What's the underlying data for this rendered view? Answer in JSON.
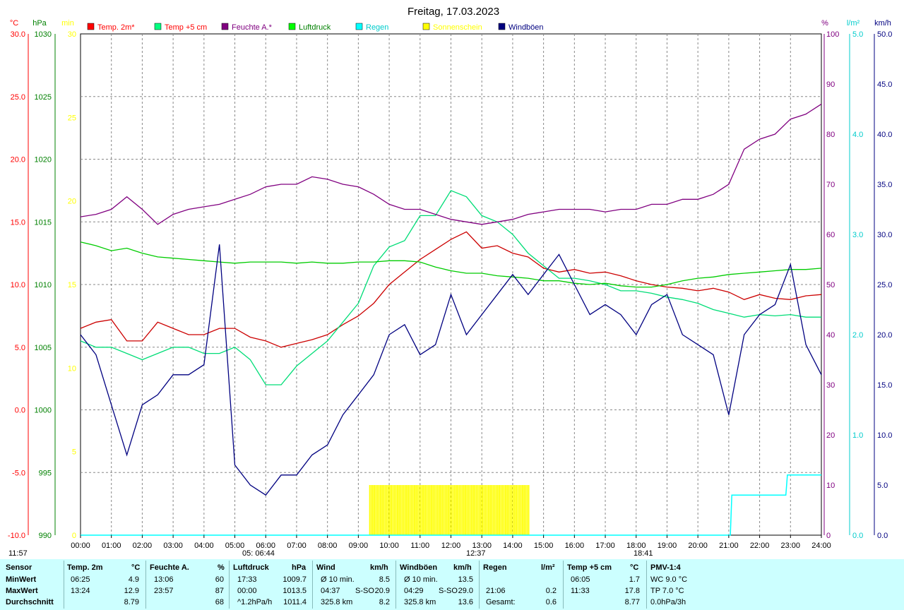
{
  "chart_data": {
    "type": "line",
    "title": "Freitag, 17.03.2023",
    "x_ticks": [
      "00:00",
      "01:00",
      "02:00",
      "03:00",
      "04:00",
      "05:00",
      "06:00",
      "07:00",
      "08:00",
      "09:00",
      "10:00",
      "11:00",
      "12:00",
      "13:00",
      "14:00",
      "15:00",
      "16:00",
      "17:00",
      "18:00",
      "19:00",
      "20:00",
      "21:00",
      "22:00",
      "23:00",
      "24:00"
    ],
    "xlim": [
      0,
      24
    ],
    "axes": {
      "temp": {
        "unit": "°C",
        "ylim": [
          -10,
          30
        ],
        "ticks": [
          "30.0",
          "25.0",
          "20.0",
          "15.0",
          "10.0",
          "5.0",
          "0.0",
          "-5.0",
          "-10.0"
        ]
      },
      "pressure": {
        "unit": "hPa",
        "ylim": [
          990,
          1030
        ],
        "ticks": [
          "1030",
          "1025",
          "1020",
          "1015",
          "1010",
          "1005",
          "1000",
          "995",
          "990"
        ]
      },
      "sunshine": {
        "unit": "min",
        "ylim": [
          0,
          30
        ],
        "ticks": [
          "30",
          "25",
          "20",
          "15",
          "10",
          "5",
          "0"
        ]
      },
      "humidity": {
        "unit": "%",
        "ylim": [
          0,
          100
        ],
        "ticks": [
          "100",
          "90",
          "80",
          "70",
          "60",
          "50",
          "40",
          "30",
          "20",
          "10",
          "0"
        ]
      },
      "rain": {
        "unit": "l/m²",
        "ylim": [
          0,
          5
        ],
        "ticks": [
          "5.0",
          "4.0",
          "3.0",
          "2.0",
          "1.0",
          "0.0"
        ]
      },
      "wind": {
        "unit": "km/h",
        "ylim": [
          0,
          50
        ],
        "ticks": [
          "50.0",
          "45.0",
          "40.0",
          "35.0",
          "30.0",
          "25.0",
          "20.0",
          "15.0",
          "10.0",
          "5.0",
          "0.0"
        ]
      }
    },
    "legend": [
      {
        "name": "Temp. 2m*",
        "color": "#ff0000",
        "text_color": "#ff0000"
      },
      {
        "name": "Temp +5 cm",
        "color": "#00ff80",
        "text_color": "#ff0000"
      },
      {
        "name": "Feuchte A.*",
        "color": "#800080",
        "text_color": "#800080"
      },
      {
        "name": "Luftdruck",
        "color": "#00ff00",
        "text_color": "#008000"
      },
      {
        "name": "Regen",
        "color": "#00ffff",
        "text_color": "#00cccc"
      },
      {
        "name": "Sonnenschein",
        "color": "#ffff00",
        "text_color": "#ffff00"
      },
      {
        "name": "Windböen",
        "color": "#000080",
        "text_color": "#000080"
      }
    ],
    "series": [
      {
        "name": "Temp. 2m*",
        "axis": "temp",
        "color": "#cc0000",
        "x": [
          0,
          0.5,
          1,
          1.5,
          2,
          2.5,
          3,
          3.5,
          4,
          4.5,
          5,
          5.5,
          6,
          6.5,
          7,
          7.5,
          8,
          8.5,
          9,
          9.5,
          10,
          10.5,
          11,
          11.5,
          12,
          12.5,
          13,
          13.5,
          14,
          14.5,
          15,
          15.5,
          16,
          16.5,
          17,
          17.5,
          18,
          18.5,
          19,
          19.5,
          20,
          20.5,
          21,
          21.5,
          22,
          22.5,
          23,
          23.5,
          24
        ],
        "y": [
          6.5,
          7,
          7.2,
          5.5,
          5.5,
          7,
          6.5,
          6,
          6,
          6.5,
          6.5,
          5.8,
          5.5,
          5,
          5.3,
          5.6,
          6,
          6.8,
          7.5,
          8.5,
          10,
          11,
          12,
          12.8,
          13.6,
          14.2,
          12.9,
          13.1,
          12.5,
          12.2,
          11.3,
          11,
          11.2,
          10.9,
          11,
          10.7,
          10.3,
          10,
          9.8,
          9.7,
          9.5,
          9.7,
          9.4,
          8.8,
          9.2,
          8.9,
          8.8,
          9.1,
          9.2
        ]
      },
      {
        "name": "Temp +5 cm",
        "axis": "temp",
        "color": "#00dd77",
        "x": [
          0,
          0.5,
          1,
          1.5,
          2,
          2.5,
          3,
          3.5,
          4,
          4.5,
          5,
          5.5,
          6,
          6.5,
          7,
          7.5,
          8,
          8.5,
          9,
          9.5,
          10,
          10.5,
          11,
          11.5,
          12,
          12.5,
          13,
          13.5,
          14,
          14.5,
          15,
          15.5,
          16,
          16.5,
          17,
          17.5,
          18,
          18.5,
          19,
          19.5,
          20,
          20.5,
          21,
          21.5,
          22,
          22.5,
          23,
          23.5,
          24
        ],
        "y": [
          5.5,
          5,
          5,
          4.5,
          4,
          4.5,
          5,
          5,
          4.5,
          4.5,
          5,
          4,
          2,
          2,
          3.5,
          4.5,
          5.5,
          7,
          8.5,
          11.5,
          13,
          13.5,
          15.5,
          15.5,
          17.5,
          17,
          15.5,
          15,
          14,
          12.5,
          11.5,
          10.5,
          10.5,
          10.3,
          10,
          9.5,
          9.5,
          9.3,
          9,
          8.8,
          8.5,
          8,
          7.7,
          7.4,
          7.6,
          7.5,
          7.6,
          7.4,
          7.4
        ]
      },
      {
        "name": "Feuchte A.*",
        "axis": "humidity",
        "color": "#800080",
        "x": [
          0,
          0.5,
          1,
          1.5,
          2,
          2.5,
          3,
          3.5,
          4,
          4.5,
          5,
          5.5,
          6,
          6.5,
          7,
          7.5,
          8,
          8.5,
          9,
          9.5,
          10,
          10.5,
          11,
          11.5,
          12,
          12.5,
          13,
          13.5,
          14,
          14.5,
          15,
          15.5,
          16,
          16.5,
          17,
          17.5,
          18,
          18.5,
          19,
          19.5,
          20,
          20.5,
          21,
          21.5,
          22,
          22.5,
          23,
          23.5,
          24
        ],
        "y": [
          63.5,
          64,
          65,
          67.5,
          65,
          62,
          64,
          65,
          65.5,
          66,
          67,
          68,
          69.5,
          70,
          70,
          71.5,
          71,
          70,
          69.5,
          68,
          66,
          65,
          65,
          64,
          63,
          62.5,
          62,
          62.5,
          63,
          64,
          64.5,
          65,
          65,
          65,
          64.5,
          65,
          65,
          66,
          66,
          67,
          67,
          68,
          70,
          77,
          79,
          80,
          83,
          84,
          86
        ]
      },
      {
        "name": "Luftdruck",
        "axis": "pressure",
        "color": "#00cc00",
        "x": [
          0,
          0.5,
          1,
          1.5,
          2,
          2.5,
          3,
          3.5,
          4,
          4.5,
          5,
          5.5,
          6,
          6.5,
          7,
          7.5,
          8,
          8.5,
          9,
          9.5,
          10,
          10.5,
          11,
          11.5,
          12,
          12.5,
          13,
          13.5,
          14,
          14.5,
          15,
          15.5,
          16,
          16.5,
          17,
          17.5,
          18,
          18.5,
          19,
          19.5,
          20,
          20.5,
          21,
          21.5,
          22,
          22.5,
          23,
          23.5,
          24
        ],
        "y": [
          1013.4,
          1013.1,
          1012.7,
          1012.9,
          1012.5,
          1012.2,
          1012.1,
          1012,
          1011.9,
          1011.8,
          1011.7,
          1011.8,
          1011.8,
          1011.8,
          1011.7,
          1011.8,
          1011.7,
          1011.7,
          1011.8,
          1011.8,
          1011.9,
          1011.9,
          1011.8,
          1011.4,
          1011.1,
          1010.9,
          1010.9,
          1010.7,
          1010.6,
          1010.5,
          1010.3,
          1010.3,
          1010.1,
          1010,
          1010.1,
          1009.9,
          1009.8,
          1009.8,
          1010,
          1010.3,
          1010.5,
          1010.6,
          1010.8,
          1010.9,
          1011,
          1011.1,
          1011.2,
          1011.2,
          1011.3
        ]
      },
      {
        "name": "Windböen",
        "axis": "wind",
        "color": "#000080",
        "x": [
          0,
          0.5,
          1,
          1.5,
          2,
          2.5,
          3,
          3.5,
          4,
          4.5,
          5,
          5.5,
          6,
          6.5,
          7,
          7.5,
          8,
          8.5,
          9,
          9.5,
          10,
          10.5,
          11,
          11.5,
          12,
          12.5,
          13,
          13.5,
          14,
          14.5,
          15,
          15.5,
          16,
          16.5,
          17,
          17.5,
          18,
          18.5,
          19,
          19.5,
          20,
          20.5,
          21,
          21.5,
          22,
          22.5,
          23,
          23.5,
          24
        ],
        "y": [
          20,
          18,
          13,
          8,
          13,
          14,
          16,
          16,
          17,
          29,
          7,
          5,
          4,
          6,
          6,
          8,
          9,
          12,
          14,
          16,
          20,
          21,
          18,
          19,
          24,
          20,
          22,
          24,
          26,
          24,
          26,
          28,
          25,
          22,
          23,
          22,
          20,
          23,
          24,
          20,
          19,
          18,
          12,
          20,
          22,
          23,
          27,
          19,
          16
        ]
      }
    ],
    "sunshine_bar": {
      "axis": "sunshine",
      "x_start": 9.35,
      "x_end": 14.55,
      "value": 3
    },
    "rain_steps": {
      "axis": "rain",
      "x": [
        0,
        21.05,
        21.1,
        22.85,
        22.9,
        24
      ],
      "y": [
        0,
        0,
        0.4,
        0.4,
        0.6,
        0.6
      ]
    },
    "markers": [
      {
        "label": "11:57",
        "color": "#ffff00"
      },
      {
        "label": "05:  06:44",
        "color": "#ffff00"
      },
      {
        "label": "12:37",
        "color": "#ffff00"
      },
      {
        "label": "18:41",
        "color": "#ffff00"
      }
    ]
  },
  "stats": {
    "headers": {
      "sensor": "Sensor",
      "temp": "Temp. 2m",
      "temp_unit": "°C",
      "hum": "Feuchte A.",
      "hum_unit": "%",
      "press": "Luftdruck",
      "press_unit": "hPa",
      "wind": "Wind",
      "wind_unit": "km/h",
      "gust": "Windböen",
      "gust_unit": "km/h",
      "rain": "Regen",
      "rain_unit": "l/m²",
      "t5": "Temp +5 cm",
      "t5_unit": "°C",
      "pmv": "PMV-1:4"
    },
    "rows": [
      {
        "label": "MinWert",
        "temp_time": "06:25",
        "temp_val": "4.9",
        "hum_time": "13:06",
        "hum_val": "60",
        "press_time": "17:33",
        "press_val": "1009.7",
        "wind_time": "Ø 10 min.",
        "wind_dir": "",
        "wind_val": "8.5",
        "gust_time": "Ø 10 min.",
        "gust_dir": "",
        "gust_val": "13.5",
        "rain_time": "",
        "rain_val": "",
        "t5_time": "06:05",
        "t5_val": "1.7",
        "pmv": "WC 9.0 °C"
      },
      {
        "label": "MaxWert",
        "temp_time": "13:24",
        "temp_val": "12.9",
        "hum_time": "23:57",
        "hum_val": "87",
        "press_time": "00:00",
        "press_val": "1013.5",
        "wind_time": "04:37",
        "wind_dir": "S-SO",
        "wind_val": "20.9",
        "gust_time": "04:29",
        "gust_dir": "S-SO",
        "gust_val": "29.0",
        "rain_time": "21:06",
        "rain_val": "0.2",
        "t5_time": "11:33",
        "t5_val": "17.8",
        "pmv": "TP 7.0 °C"
      },
      {
        "label": "Durchschnitt",
        "temp_time": "",
        "temp_val": "8.79",
        "hum_time": "",
        "hum_val": "68",
        "press_time": "^1.2hPa/h",
        "press_val": "1011.4",
        "wind_time": "325.8 km",
        "wind_dir": "",
        "wind_val": "8.2",
        "gust_time": "325.8 km",
        "gust_dir": "",
        "gust_val": "13.6",
        "rain_time": "Gesamt:",
        "rain_val": "0.6",
        "t5_time": "",
        "t5_val": "8.77",
        "pmv": "0.0hPa/3h"
      }
    ]
  }
}
